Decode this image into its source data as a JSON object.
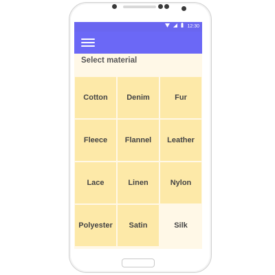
{
  "status_bar": {
    "time": "12:30",
    "wifi_icon": "wifi-icon",
    "signal_icon": "signal-icon",
    "battery_icon": "battery-icon"
  },
  "app_bar": {
    "menu_icon": "hamburger-menu-icon",
    "color": "#6b68f6"
  },
  "heading": "Select material",
  "materials": [
    {
      "label": "Cotton",
      "selected": false
    },
    {
      "label": "Denim",
      "selected": false
    },
    {
      "label": "Fur",
      "selected": false
    },
    {
      "label": "Fleece",
      "selected": false
    },
    {
      "label": "Flannel",
      "selected": false
    },
    {
      "label": "Leather",
      "selected": false
    },
    {
      "label": "Lace",
      "selected": false
    },
    {
      "label": "Linen",
      "selected": false
    },
    {
      "label": "Nylon",
      "selected": false
    },
    {
      "label": "Polyester",
      "selected": false
    },
    {
      "label": "Satin",
      "selected": false
    },
    {
      "label": "Silk",
      "selected": true
    }
  ],
  "colors": {
    "tile": "#fde9a8",
    "tile_selected": "#fff8e7",
    "screen_background": "#fff8e7"
  }
}
